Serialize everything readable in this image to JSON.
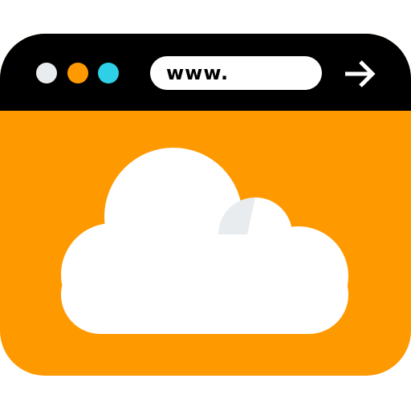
{
  "address_bar": {
    "text": "www."
  },
  "title_bar": {
    "dots": [
      {
        "name": "dot-close",
        "color": "#e8ecef"
      },
      {
        "name": "dot-minimize",
        "color": "#ff9900"
      },
      {
        "name": "dot-maximize",
        "color": "#2dd0e6"
      }
    ]
  },
  "colors": {
    "frame": "#000000",
    "content": "#ff9900",
    "cloud": "#ffffff",
    "cloud_shadow": "#e8ecef"
  },
  "icons": {
    "go": "arrow-right-icon",
    "content": "cloud-icon"
  }
}
